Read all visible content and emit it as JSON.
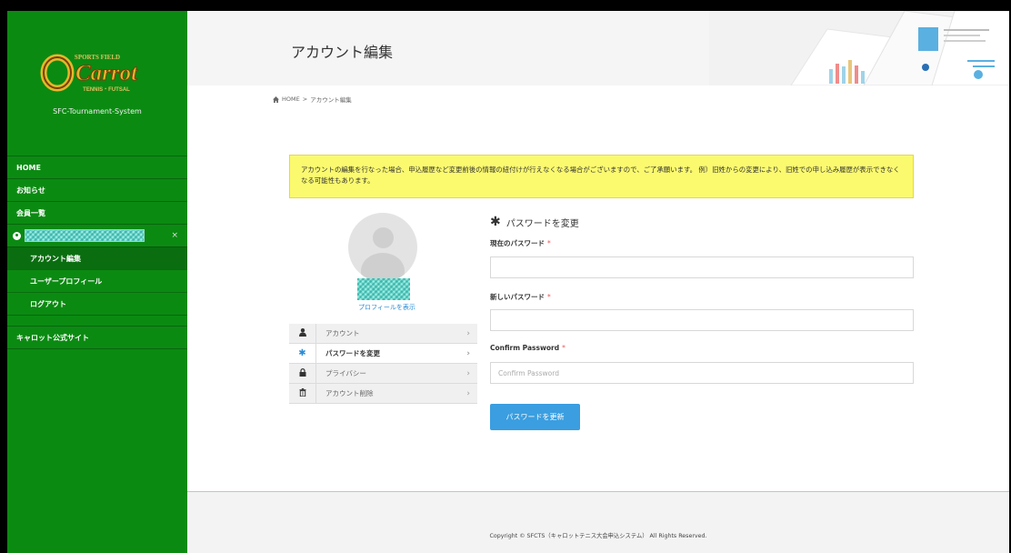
{
  "sidebar": {
    "logo_text": "Carrot",
    "logo_top": "SPORTS FIELD",
    "logo_bottom": "TENNIS・FUTSAL",
    "site_name": "SFC-Tournament-System",
    "items": [
      {
        "label": "HOME"
      },
      {
        "label": "お知らせ"
      },
      {
        "label": "会員一覧"
      }
    ],
    "user_close": "×",
    "sub_items": [
      {
        "label": "アカウント編集"
      },
      {
        "label": "ユーザープロフィール"
      },
      {
        "label": "ログアウト"
      }
    ],
    "external": {
      "label": "キャロット公式サイト"
    }
  },
  "header": {
    "title": "アカウント編集"
  },
  "breadcrumb": {
    "home": "HOME",
    "sep": ">",
    "current": "アカウント編集"
  },
  "notice": {
    "text": "アカウントの編集を行なった場合、申込履歴など変更前後の情報の紐付けが行えなくなる場合がございますので、ご了承願います。 例）旧姓からの変更により、旧姓での申し込み履歴が表示できなくなる可能性もあります。"
  },
  "profile": {
    "view_link": "プロフィールを表示"
  },
  "settings_menu": [
    {
      "icon": "user-icon",
      "label": "アカウント"
    },
    {
      "icon": "asterisk-icon",
      "label": "パスワードを変更"
    },
    {
      "icon": "lock-icon",
      "label": "プライバシー"
    },
    {
      "icon": "trash-icon",
      "label": "アカウント削除"
    }
  ],
  "form": {
    "title": "パスワードを変更",
    "current_label": "現在のパスワード",
    "new_label": "新しいパスワード",
    "confirm_label": "Confirm Password",
    "confirm_placeholder": "Confirm Password",
    "required_mark": "*",
    "submit_label": "パスワードを更新"
  },
  "footer": {
    "copyright": "Copyright © SFCTS（キャロットテニス大会申込システム） All Rights Reserved."
  },
  "colors": {
    "sidebar_bg": "#0b8a12",
    "notice_bg": "#fbfa6f",
    "accent_blue": "#3a9ee0"
  }
}
